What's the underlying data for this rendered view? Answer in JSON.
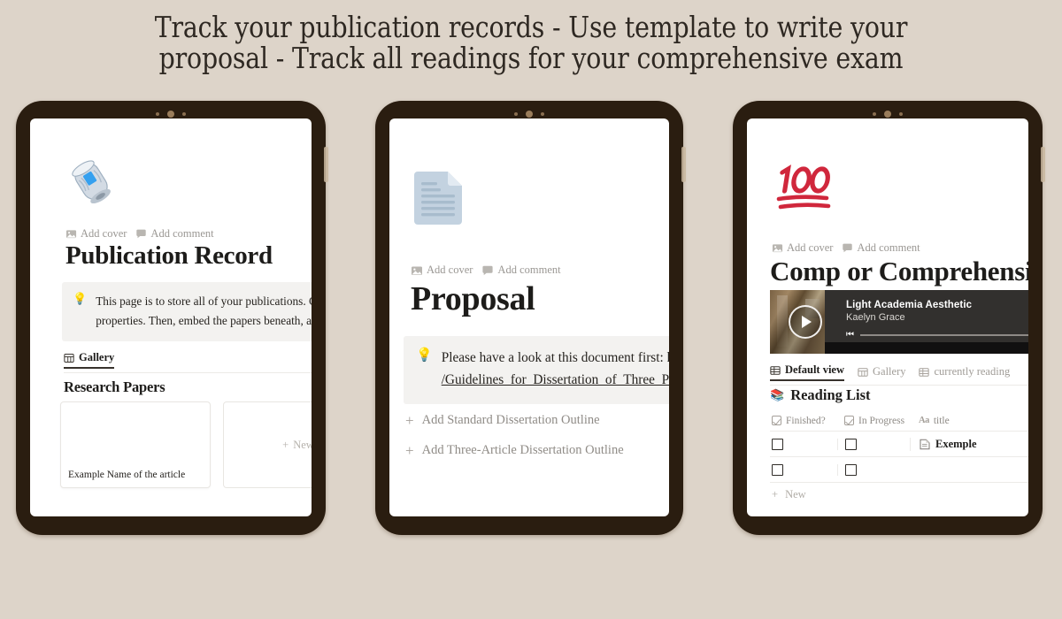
{
  "headline": "Track your publication records - Use template to write your\nproposal  - Track all readings for your comprehensive exam",
  "colors": {
    "background": "#ddd4c9",
    "bezel": "#2a1d10",
    "camera_dot": "#8a6f50",
    "accent_red": "#d0273c",
    "callout_bg": "#f3f2f0",
    "player_bg": "#32302e"
  },
  "tablets": [
    {
      "id": "publication-record",
      "icon_name": "rolled-newspaper-emoji",
      "meta": [
        {
          "icon": "image-icon",
          "label": "Add cover"
        },
        {
          "icon": "comment-icon",
          "label": "Add comment"
        }
      ],
      "title": "Publication Record",
      "callout": {
        "icon": "lightbulb-emoji",
        "line1": "This page is to store all of your publications. Click on",
        "line2": "properties. Then, embed the papers beneath, and voilà."
      },
      "view_tabs": [
        {
          "icon": "gallery-view-icon",
          "label": "Gallery",
          "active": true
        }
      ],
      "section_title": "Research Papers",
      "gallery": [
        {
          "name": "Example Name of the article"
        },
        {
          "name": "+  New",
          "is_new": true,
          "new_label": "New"
        }
      ]
    },
    {
      "id": "proposal",
      "icon_name": "document-page-icon",
      "meta": [
        {
          "icon": "image-icon",
          "label": "Add cover"
        },
        {
          "icon": "comment-icon",
          "label": "Add comment"
        }
      ],
      "title": "Proposal",
      "callout": {
        "icon": "lightbulb-emoji",
        "line1": "Please have a look at this document first: h",
        "line2": "/Guidelines_for_Dissertation_of_Three_P"
      },
      "toggles": [
        {
          "label": "Add Standard Dissertation Outline"
        },
        {
          "label": "Add Three-Article Dissertation Outline"
        }
      ]
    },
    {
      "id": "comp-exam",
      "icon_name": "hundred-points-emoji",
      "icon_text": "100",
      "meta": [
        {
          "icon": "image-icon",
          "label": "Add cover"
        },
        {
          "icon": "comment-icon",
          "label": "Add comment"
        }
      ],
      "title": "Comp or Comprehensiv",
      "player": {
        "title": "Light Academia Aesthetic",
        "artist": "Kaelyn Grace",
        "play_icon": "play-icon",
        "prev_icon": "previous-track-icon"
      },
      "view_tabs": [
        {
          "icon": "table-view-icon",
          "label": "Default view",
          "active": true
        },
        {
          "icon": "gallery-view-icon",
          "label": "Gallery",
          "active": false
        },
        {
          "icon": "table-view-icon",
          "label": "currently reading",
          "active": false
        }
      ],
      "db_title": "Reading List",
      "db_emoji": "books-emoji",
      "columns": [
        {
          "icon": "checkbox-icon",
          "label": "Finished?"
        },
        {
          "icon": "checkbox-icon",
          "label": "In Progress"
        },
        {
          "icon": "text-type-icon",
          "label": "title"
        }
      ],
      "rows": [
        {
          "finished": false,
          "in_progress": false,
          "title": "Exemple",
          "title_icon": "page-icon"
        },
        {
          "finished": false,
          "in_progress": false,
          "title": "",
          "title_icon": ""
        }
      ],
      "new_row_label": "New"
    }
  ]
}
